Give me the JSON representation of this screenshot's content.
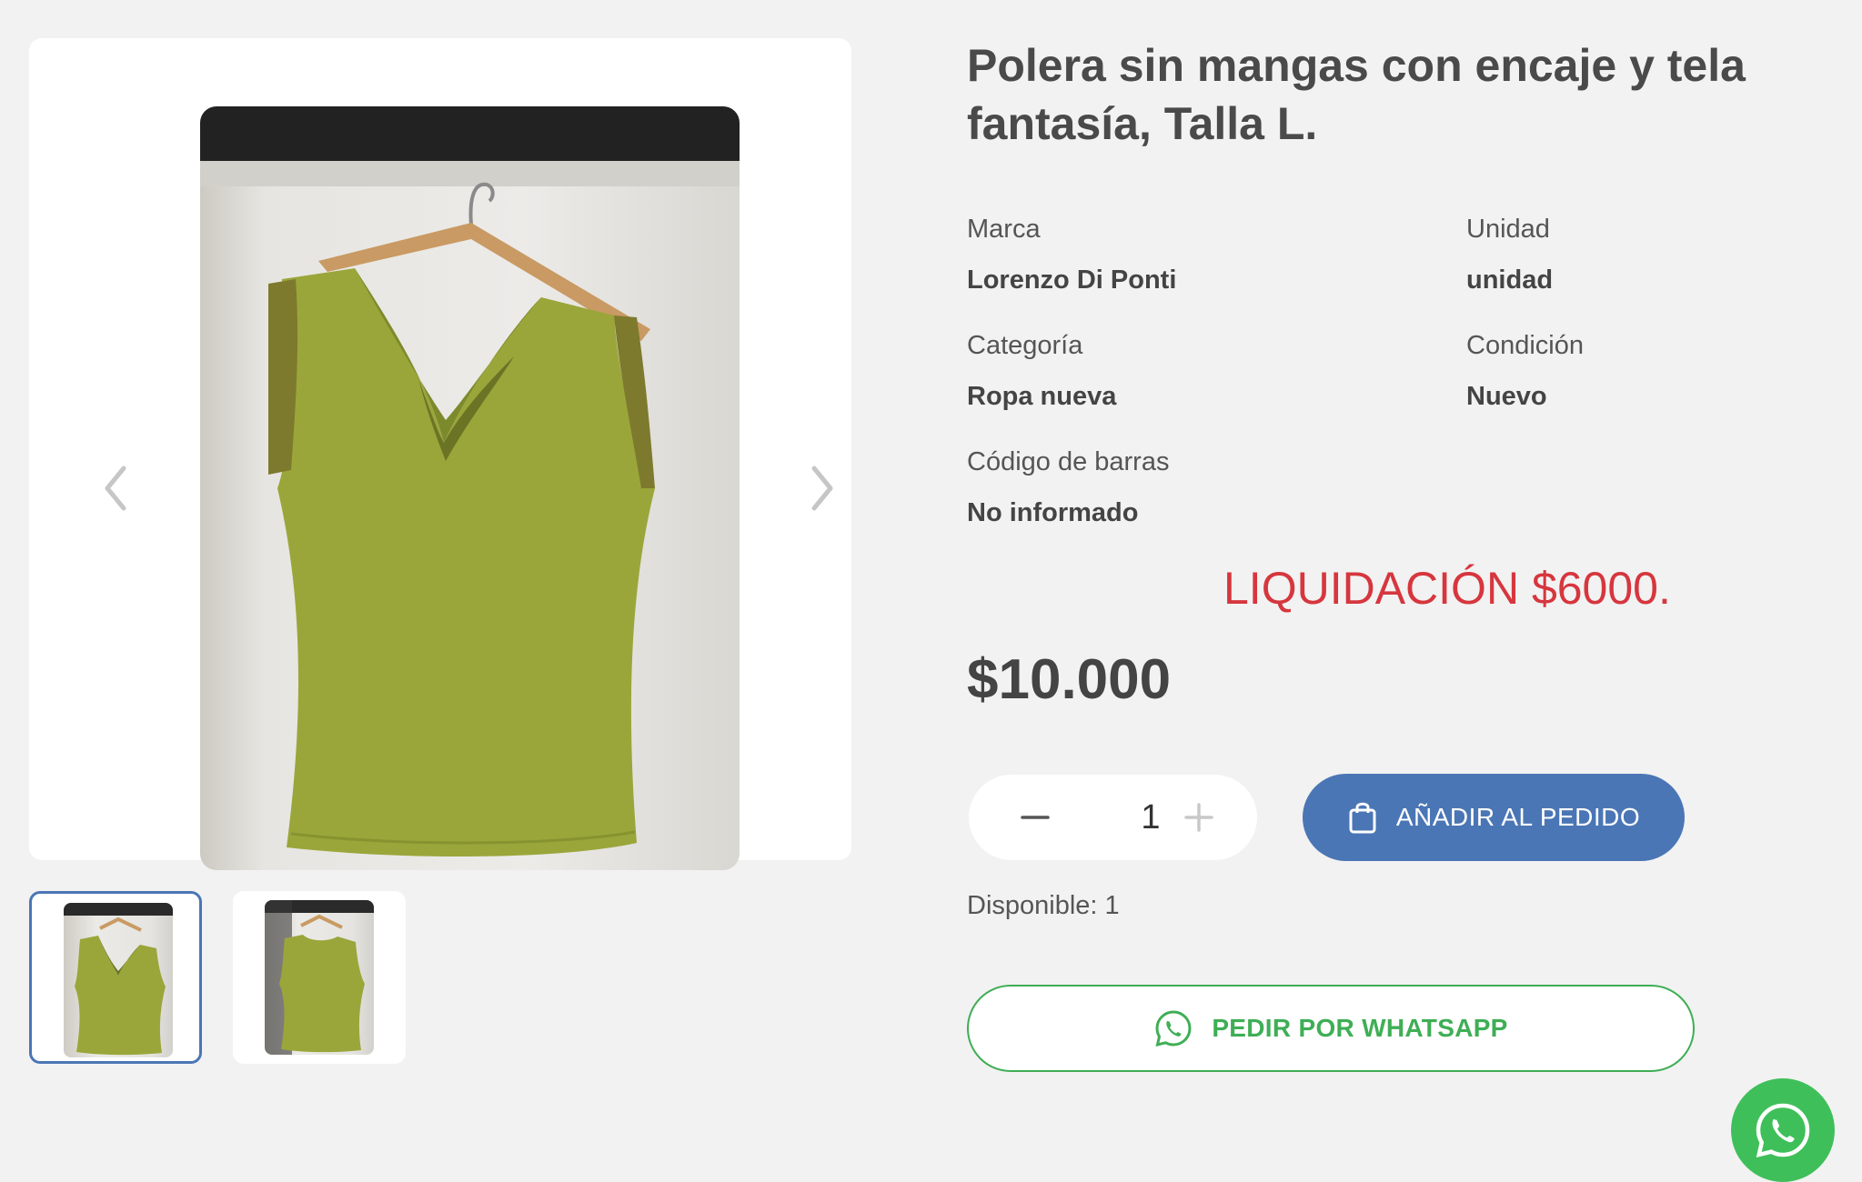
{
  "product": {
    "title": "Polera sin mangas con encaje y tela fantasía, Talla L.",
    "image_alt": "polera verde sin mangas colgada en un gancho",
    "specs": {
      "brand_label": "Marca",
      "brand_value": "Lorenzo Di Ponti",
      "unit_label": "Unidad",
      "unit_value": "unidad",
      "category_label": "Categoría",
      "category_value": "Ropa nueva",
      "condition_label": "Condición",
      "condition_value": "Nuevo",
      "barcode_label": "Código de barras",
      "barcode_value": "No informado"
    },
    "promo_text": "LIQUIDACIÓN $6000.",
    "price": "$10.000",
    "quantity": "1",
    "stock_text": "Disponible: 1"
  },
  "gallery": {
    "thumbnails": [
      {
        "name": "front",
        "active": true
      },
      {
        "name": "back",
        "active": false
      }
    ]
  },
  "actions": {
    "add_to_order_label": "AÑADIR AL PEDIDO",
    "whatsapp_label": "PEDIR POR WHATSAPP"
  },
  "icons": {
    "prev": "chevron-left-icon",
    "next": "chevron-right-icon",
    "minus": "minus-icon",
    "plus": "plus-icon",
    "bag": "shopping-bag-icon",
    "whatsapp": "whatsapp-icon"
  },
  "colors": {
    "accent": "#4b76b5",
    "whatsapp": "#3fae55",
    "promo": "#d6363e",
    "garment": "#9aa63a"
  }
}
